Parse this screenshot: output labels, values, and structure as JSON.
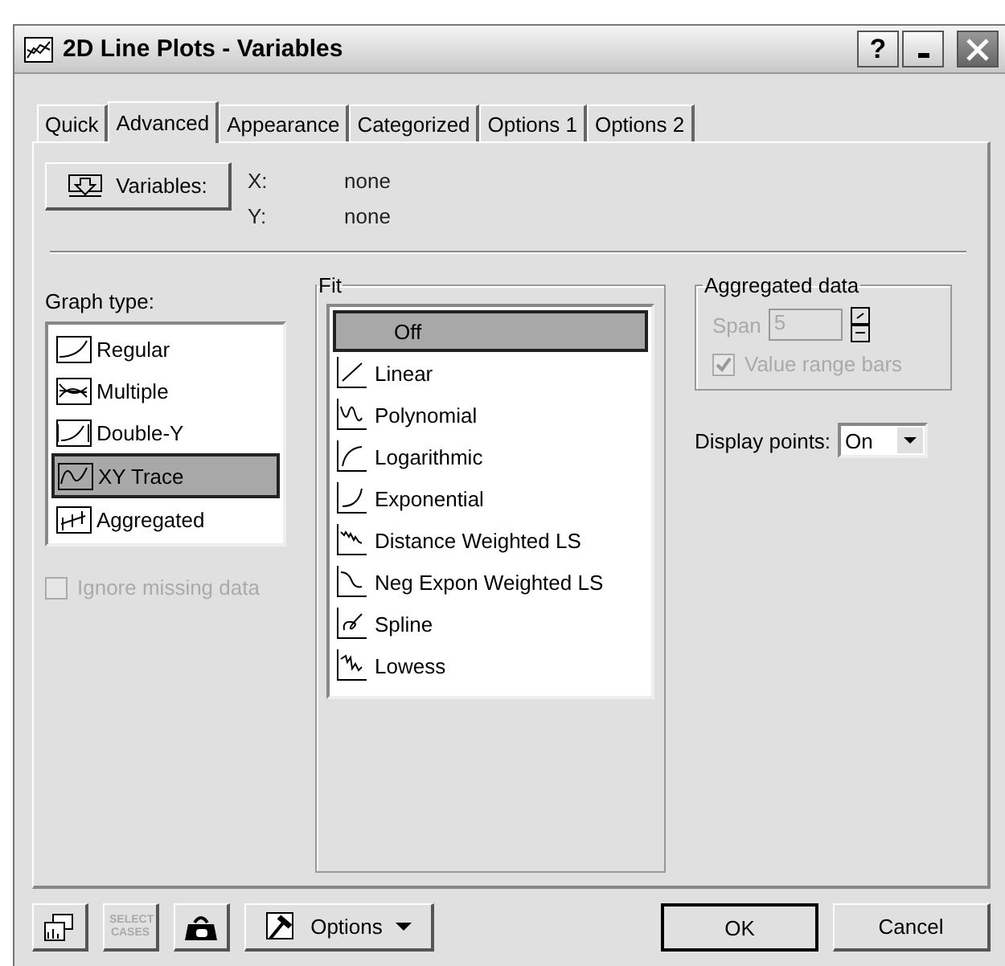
{
  "window": {
    "title": "2D Line Plots - Variables",
    "help": "?"
  },
  "tabs": [
    {
      "label": "Quick",
      "selected": false
    },
    {
      "label": "Advanced",
      "selected": true
    },
    {
      "label": "Appearance",
      "selected": false
    },
    {
      "label": "Categorized",
      "selected": false
    },
    {
      "label": "Options 1",
      "selected": false
    },
    {
      "label": "Options 2",
      "selected": false
    }
  ],
  "variables": {
    "button": "Variables:",
    "rows": [
      {
        "axis": "X:",
        "value": "none"
      },
      {
        "axis": "Y:",
        "value": "none"
      }
    ]
  },
  "graph_type": {
    "label": "Graph type:",
    "items": [
      {
        "label": "Regular",
        "kind": "regular",
        "selected": false
      },
      {
        "label": "Multiple",
        "kind": "multiple",
        "selected": false
      },
      {
        "label": "Double-Y",
        "kind": "double",
        "selected": false
      },
      {
        "label": "XY Trace",
        "kind": "trace",
        "selected": true
      },
      {
        "label": "Aggregated",
        "kind": "aggregated",
        "selected": false
      }
    ]
  },
  "ignore_missing": {
    "label": "Ignore missing data",
    "checked": false,
    "disabled": true
  },
  "fit": {
    "title": "Fit",
    "items": [
      {
        "label": "Off",
        "kind": "off",
        "selected": true
      },
      {
        "label": "Linear",
        "kind": "linear",
        "selected": false
      },
      {
        "label": "Polynomial",
        "kind": "polynomial",
        "selected": false
      },
      {
        "label": "Logarithmic",
        "kind": "log",
        "selected": false
      },
      {
        "label": "Exponential",
        "kind": "exp",
        "selected": false
      },
      {
        "label": "Distance Weighted LS",
        "kind": "dwls",
        "selected": false
      },
      {
        "label": "Neg Expon Weighted LS",
        "kind": "newls",
        "selected": false
      },
      {
        "label": "Spline",
        "kind": "spline",
        "selected": false
      },
      {
        "label": "Lowess",
        "kind": "lowess",
        "selected": false
      }
    ]
  },
  "aggregated": {
    "title": "Aggregated data",
    "disabled": true,
    "span_label": "Span",
    "span_value": "5",
    "range_bars": {
      "label": "Value range bars",
      "checked": true
    }
  },
  "display_points": {
    "label": "Display points:",
    "value": "On"
  },
  "footer": {
    "tools": [
      {
        "kind": "windows",
        "disabled": false
      },
      {
        "kind": "select",
        "text": "SELECT CASES",
        "disabled": true
      },
      {
        "kind": "weight",
        "disabled": false
      }
    ],
    "options": "Options",
    "ok": "OK",
    "cancel": "Cancel"
  }
}
